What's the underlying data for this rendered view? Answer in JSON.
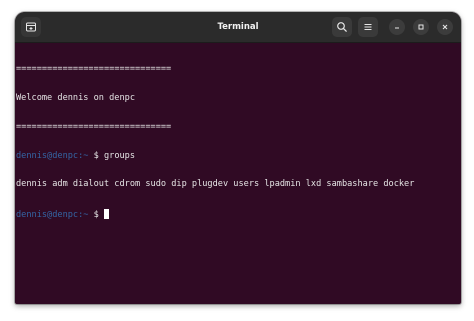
{
  "window": {
    "title": "Terminal"
  },
  "toolbar": {
    "new_tab_icon": "new-tab-icon",
    "search_icon": "search-icon",
    "menu_icon": "hamburger-menu-icon",
    "minimize_icon": "minimize-icon",
    "maximize_icon": "maximize-icon",
    "close_icon": "close-icon"
  },
  "colors": {
    "terminal_bg": "#300a24",
    "titlebar_bg": "#2b2b2b",
    "prompt": "#3465a4",
    "text": "#e5e5e5"
  },
  "terminal": {
    "lines": [
      {
        "text": "=============================="
      },
      {
        "text": "Welcome dennis on denpc"
      },
      {
        "text": "=============================="
      },
      {
        "prompt_user": "dennis@denpc",
        "prompt_path": ":~",
        "prompt_symbol": " $ ",
        "command": "groups"
      },
      {
        "text": "dennis adm dialout cdrom sudo dip plugdev users lpadmin lxd sambashare docker"
      },
      {
        "prompt_user": "dennis@denpc",
        "prompt_path": ":~",
        "prompt_symbol": " $ ",
        "command": ""
      }
    ]
  }
}
